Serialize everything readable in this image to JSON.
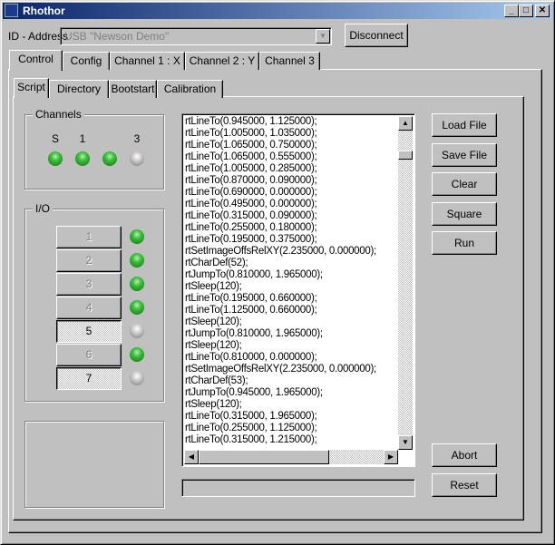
{
  "window": {
    "title": "Rhothor"
  },
  "id_address": {
    "label": "ID - Address",
    "value": "USB \"Newson Demo\"",
    "disconnect_label": "Disconnect"
  },
  "tabs": [
    "Control",
    "Config",
    "Channel 1 : X",
    "Channel 2 : Y",
    "Channel 3"
  ],
  "subtabs": [
    "Script",
    "Directory",
    "Bootstart",
    "Calibration"
  ],
  "channels": {
    "title": "Channels",
    "labels": [
      "S",
      "1",
      "",
      "3"
    ],
    "states": [
      true,
      true,
      true,
      false
    ]
  },
  "io": {
    "title": "I/O",
    "buttons": [
      {
        "label": "1",
        "pressed": false,
        "led": true
      },
      {
        "label": "2",
        "pressed": false,
        "led": true
      },
      {
        "label": "3",
        "pressed": false,
        "led": true
      },
      {
        "label": "4",
        "pressed": false,
        "led": true
      },
      {
        "label": "5",
        "pressed": true,
        "led": false
      },
      {
        "label": "6",
        "pressed": false,
        "led": true
      },
      {
        "label": "7",
        "pressed": true,
        "led": false
      }
    ]
  },
  "script_lines": [
    "rtLineTo(0.945000, 1.125000);",
    "rtLineTo(1.005000, 1.035000);",
    "rtLineTo(1.065000, 0.750000);",
    "rtLineTo(1.065000, 0.555000);",
    "rtLineTo(1.005000, 0.285000);",
    "rtLineTo(0.870000, 0.090000);",
    "rtLineTo(0.690000, 0.000000);",
    "rtLineTo(0.495000, 0.000000);",
    "rtLineTo(0.315000, 0.090000);",
    "rtLineTo(0.255000, 0.180000);",
    "rtLineTo(0.195000, 0.375000);",
    "rtSetImageOffsRelXY(2.235000, 0.000000);",
    "rtCharDef(52);",
    "rtJumpTo(0.810000, 1.965000);",
    "rtSleep(120);",
    "rtLineTo(0.195000, 0.660000);",
    "rtLineTo(1.125000, 0.660000);",
    "rtSleep(120);",
    "rtJumpTo(0.810000, 1.965000);",
    "rtSleep(120);",
    "rtLineTo(0.810000, 0.000000);",
    "rtSetImageOffsRelXY(2.235000, 0.000000);",
    "rtCharDef(53);",
    "rtJumpTo(0.945000, 1.965000);",
    "rtSleep(120);",
    "rtLineTo(0.315000, 1.965000);",
    "rtLineTo(0.255000, 1.125000);",
    "rtLineTo(0.315000, 1.215000);"
  ],
  "buttons": {
    "load": "Load File",
    "save": "Save File",
    "clear": "Clear",
    "square": "Square",
    "run": "Run",
    "abort": "Abort",
    "reset": "Reset"
  },
  "progress": 0
}
